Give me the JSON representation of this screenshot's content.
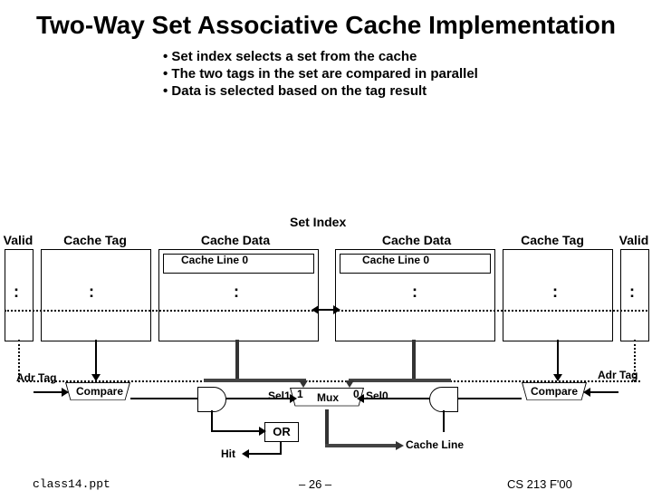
{
  "title": "Two-Way Set Associative Cache Implementation",
  "bullets": {
    "b1": "Set index selects a set from the cache",
    "b2": "The two tags in the set are compared in parallel",
    "b3": "Data is selected based on the tag result"
  },
  "labels": {
    "set_index": "Set Index",
    "valid_l": "Valid",
    "valid_r": "Valid",
    "cache_tag_l": "Cache Tag",
    "cache_tag_r": "Cache Tag",
    "cache_data_l": "Cache Data",
    "cache_data_r": "Cache Data",
    "cache_line0_l": "Cache Line 0",
    "cache_line0_r": "Cache Line 0",
    "adr_tag_l": "Adr Tag",
    "adr_tag_r": "Adr Tag",
    "compare_l": "Compare",
    "compare_r": "Compare",
    "sel1": "Sel1",
    "sel0": "Sel0",
    "one_l": "1",
    "zero_r": "0",
    "mux": "Mux",
    "or": "OR",
    "hit": "Hit",
    "cache_line_out": "Cache Line"
  },
  "footer": {
    "left": "class14.ppt",
    "center": "– 26 –",
    "right": "CS 213 F'00"
  }
}
